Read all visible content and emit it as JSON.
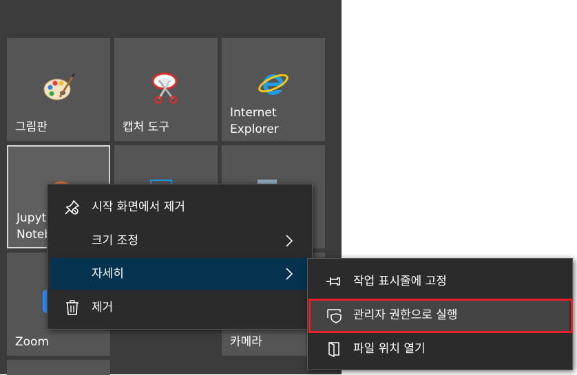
{
  "tiles": {
    "paint": {
      "label": "그림판",
      "icon": "paint-palette-icon"
    },
    "snipping": {
      "label": "캡처 도구",
      "icon": "snipping-tool-icon"
    },
    "ie": {
      "label": "Internet Explorer",
      "line1": "Internet",
      "line2": "Explorer",
      "icon": "internet-explorer-icon"
    },
    "jupyter": {
      "label": "Jupyter Notebook",
      "visible": "Jupyte",
      "visible2": "Noteb",
      "icon": "jupyter-icon"
    },
    "zoom": {
      "label": "Zoom",
      "icon": "zoom-icon"
    },
    "camera": {
      "label": "카메라",
      "icon": "camera-icon"
    }
  },
  "context_menu": {
    "items": [
      {
        "label": "시작 화면에서 제거",
        "icon": "unpin-icon",
        "has_submenu": false
      },
      {
        "label": "크기 조정",
        "icon": "",
        "has_submenu": true
      },
      {
        "label": "자세히",
        "icon": "",
        "has_submenu": true,
        "active": true
      },
      {
        "label": "제거",
        "icon": "trash-icon",
        "has_submenu": false
      }
    ]
  },
  "submenu": {
    "items": [
      {
        "label": "작업 표시줄에 고정",
        "icon": "pin-icon"
      },
      {
        "label": "관리자 권한으로 실행",
        "icon": "admin-shield-icon",
        "highlighted": true
      },
      {
        "label": "파일 위치 열기",
        "icon": "open-file-location-icon"
      }
    ]
  },
  "colors": {
    "panel": "#3c3c3c",
    "tile": "#555555",
    "menu": "#2b2b2b",
    "active": "#05334f",
    "highlight": "#e8202a"
  }
}
